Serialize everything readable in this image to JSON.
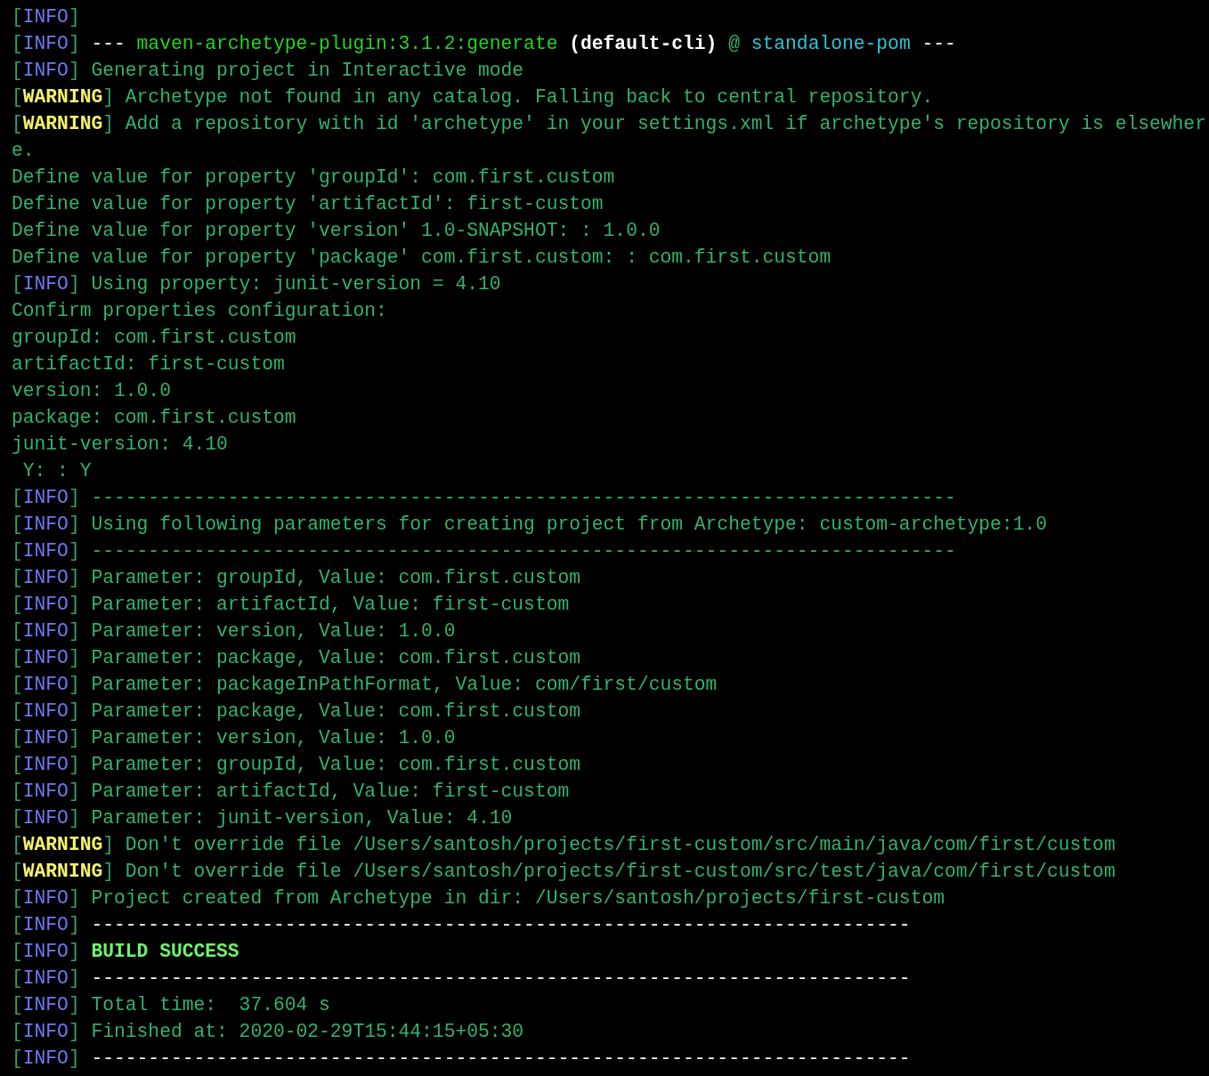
{
  "lines": [
    {
      "tag": {
        "kind": "info",
        "parts": [
          "[",
          "INFO",
          "]"
        ]
      }
    },
    {
      "tag": {
        "kind": "info",
        "parts": [
          "[",
          "INFO",
          "]"
        ]
      },
      "segments": [
        {
          "kind": "white",
          "text": "---"
        },
        {
          "kind": "bright",
          "text": " maven-archetype-plugin:3.1.2:generate "
        },
        {
          "kind": "bold",
          "text": "(default-cli)"
        },
        {
          "kind": "plain",
          "text": " @ "
        },
        {
          "kind": "cyan",
          "text": "standalone-pom"
        },
        {
          "kind": "white",
          "text": " ---"
        }
      ]
    },
    {
      "tag": {
        "kind": "info",
        "parts": [
          "[",
          "INFO",
          "]"
        ]
      },
      "segments": [
        {
          "kind": "plain",
          "text": "Generating project in Interactive mode"
        }
      ]
    },
    {
      "tag": {
        "kind": "warning",
        "parts": [
          "[",
          "WARNING",
          "]"
        ]
      },
      "segments": [
        {
          "kind": "plain",
          "text": "Archetype not found in any catalog. Falling back to central repository."
        }
      ]
    },
    {
      "tag": {
        "kind": "warning",
        "parts": [
          "[",
          "WARNING",
          "]"
        ]
      },
      "segments": [
        {
          "kind": "plain",
          "text": "Add a repository with id 'archetype' in your settings.xml if archetype's repository is elsewher"
        }
      ]
    },
    {
      "segments": [
        {
          "kind": "plain",
          "text": "e."
        }
      ]
    },
    {
      "segments": [
        {
          "kind": "plain",
          "text": "Define value for property 'groupId': com.first.custom"
        }
      ]
    },
    {
      "segments": [
        {
          "kind": "plain",
          "text": "Define value for property 'artifactId': first-custom"
        }
      ]
    },
    {
      "segments": [
        {
          "kind": "plain",
          "text": "Define value for property 'version' 1.0-SNAPSHOT: : 1.0.0"
        }
      ]
    },
    {
      "segments": [
        {
          "kind": "plain",
          "text": "Define value for property 'package' com.first.custom: : com.first.custom"
        }
      ]
    },
    {
      "tag": {
        "kind": "info",
        "parts": [
          "[",
          "INFO",
          "]"
        ]
      },
      "segments": [
        {
          "kind": "plain",
          "text": "Using property: junit-version = 4.10"
        }
      ]
    },
    {
      "segments": [
        {
          "kind": "plain",
          "text": "Confirm properties configuration:"
        }
      ]
    },
    {
      "segments": [
        {
          "kind": "plain",
          "text": "groupId: com.first.custom"
        }
      ]
    },
    {
      "segments": [
        {
          "kind": "plain",
          "text": "artifactId: first-custom"
        }
      ]
    },
    {
      "segments": [
        {
          "kind": "plain",
          "text": "version: 1.0.0"
        }
      ]
    },
    {
      "segments": [
        {
          "kind": "plain",
          "text": "package: com.first.custom"
        }
      ]
    },
    {
      "segments": [
        {
          "kind": "plain",
          "text": "junit-version: 4.10"
        }
      ]
    },
    {
      "segments": [
        {
          "kind": "plain",
          "text": " Y: : Y"
        }
      ]
    },
    {
      "tag": {
        "kind": "info",
        "parts": [
          "[",
          "INFO",
          "]"
        ]
      },
      "segments": [
        {
          "kind": "plain",
          "text": "----------------------------------------------------------------------------"
        }
      ]
    },
    {
      "tag": {
        "kind": "info",
        "parts": [
          "[",
          "INFO",
          "]"
        ]
      },
      "segments": [
        {
          "kind": "plain",
          "text": "Using following parameters for creating project from Archetype: custom-archetype:1.0"
        }
      ]
    },
    {
      "tag": {
        "kind": "info",
        "parts": [
          "[",
          "INFO",
          "]"
        ]
      },
      "segments": [
        {
          "kind": "plain",
          "text": "----------------------------------------------------------------------------"
        }
      ]
    },
    {
      "tag": {
        "kind": "info",
        "parts": [
          "[",
          "INFO",
          "]"
        ]
      },
      "segments": [
        {
          "kind": "plain",
          "text": "Parameter: groupId, Value: com.first.custom"
        }
      ]
    },
    {
      "tag": {
        "kind": "info",
        "parts": [
          "[",
          "INFO",
          "]"
        ]
      },
      "segments": [
        {
          "kind": "plain",
          "text": "Parameter: artifactId, Value: first-custom"
        }
      ]
    },
    {
      "tag": {
        "kind": "info",
        "parts": [
          "[",
          "INFO",
          "]"
        ]
      },
      "segments": [
        {
          "kind": "plain",
          "text": "Parameter: version, Value: 1.0.0"
        }
      ]
    },
    {
      "tag": {
        "kind": "info",
        "parts": [
          "[",
          "INFO",
          "]"
        ]
      },
      "segments": [
        {
          "kind": "plain",
          "text": "Parameter: package, Value: com.first.custom"
        }
      ]
    },
    {
      "tag": {
        "kind": "info",
        "parts": [
          "[",
          "INFO",
          "]"
        ]
      },
      "segments": [
        {
          "kind": "plain",
          "text": "Parameter: packageInPathFormat, Value: com/first/custom"
        }
      ]
    },
    {
      "tag": {
        "kind": "info",
        "parts": [
          "[",
          "INFO",
          "]"
        ]
      },
      "segments": [
        {
          "kind": "plain",
          "text": "Parameter: package, Value: com.first.custom"
        }
      ]
    },
    {
      "tag": {
        "kind": "info",
        "parts": [
          "[",
          "INFO",
          "]"
        ]
      },
      "segments": [
        {
          "kind": "plain",
          "text": "Parameter: version, Value: 1.0.0"
        }
      ]
    },
    {
      "tag": {
        "kind": "info",
        "parts": [
          "[",
          "INFO",
          "]"
        ]
      },
      "segments": [
        {
          "kind": "plain",
          "text": "Parameter: groupId, Value: com.first.custom"
        }
      ]
    },
    {
      "tag": {
        "kind": "info",
        "parts": [
          "[",
          "INFO",
          "]"
        ]
      },
      "segments": [
        {
          "kind": "plain",
          "text": "Parameter: artifactId, Value: first-custom"
        }
      ]
    },
    {
      "tag": {
        "kind": "info",
        "parts": [
          "[",
          "INFO",
          "]"
        ]
      },
      "segments": [
        {
          "kind": "plain",
          "text": "Parameter: junit-version, Value: 4.10"
        }
      ]
    },
    {
      "tag": {
        "kind": "warning",
        "parts": [
          "[",
          "WARNING",
          "]"
        ]
      },
      "segments": [
        {
          "kind": "plain",
          "text": "Don't override file /Users/santosh/projects/first-custom/src/main/java/com/first/custom"
        }
      ]
    },
    {
      "tag": {
        "kind": "warning",
        "parts": [
          "[",
          "WARNING",
          "]"
        ]
      },
      "segments": [
        {
          "kind": "plain",
          "text": "Don't override file /Users/santosh/projects/first-custom/src/test/java/com/first/custom"
        }
      ]
    },
    {
      "tag": {
        "kind": "info",
        "parts": [
          "[",
          "INFO",
          "]"
        ]
      },
      "segments": [
        {
          "kind": "plain",
          "text": "Project created from Archetype in dir: /Users/santosh/projects/first-custom"
        }
      ]
    },
    {
      "tag": {
        "kind": "info",
        "parts": [
          "[",
          "INFO",
          "]"
        ]
      },
      "segments": [
        {
          "kind": "white",
          "text": "------------------------------------------------------------------------"
        }
      ]
    },
    {
      "tag": {
        "kind": "info",
        "parts": [
          "[",
          "INFO",
          "]"
        ]
      },
      "segments": [
        {
          "kind": "success",
          "text": "BUILD SUCCESS"
        }
      ]
    },
    {
      "tag": {
        "kind": "info",
        "parts": [
          "[",
          "INFO",
          "]"
        ]
      },
      "segments": [
        {
          "kind": "white",
          "text": "------------------------------------------------------------------------"
        }
      ]
    },
    {
      "tag": {
        "kind": "info",
        "parts": [
          "[",
          "INFO",
          "]"
        ]
      },
      "segments": [
        {
          "kind": "plain",
          "text": "Total time:  37.604 s"
        }
      ]
    },
    {
      "tag": {
        "kind": "info",
        "parts": [
          "[",
          "INFO",
          "]"
        ]
      },
      "segments": [
        {
          "kind": "plain",
          "text": "Finished at: 2020-02-29T15:44:15+05:30"
        }
      ]
    },
    {
      "tag": {
        "kind": "info",
        "parts": [
          "[",
          "INFO",
          "]"
        ]
      },
      "segments": [
        {
          "kind": "white",
          "text": "------------------------------------------------------------------------"
        }
      ]
    }
  ]
}
